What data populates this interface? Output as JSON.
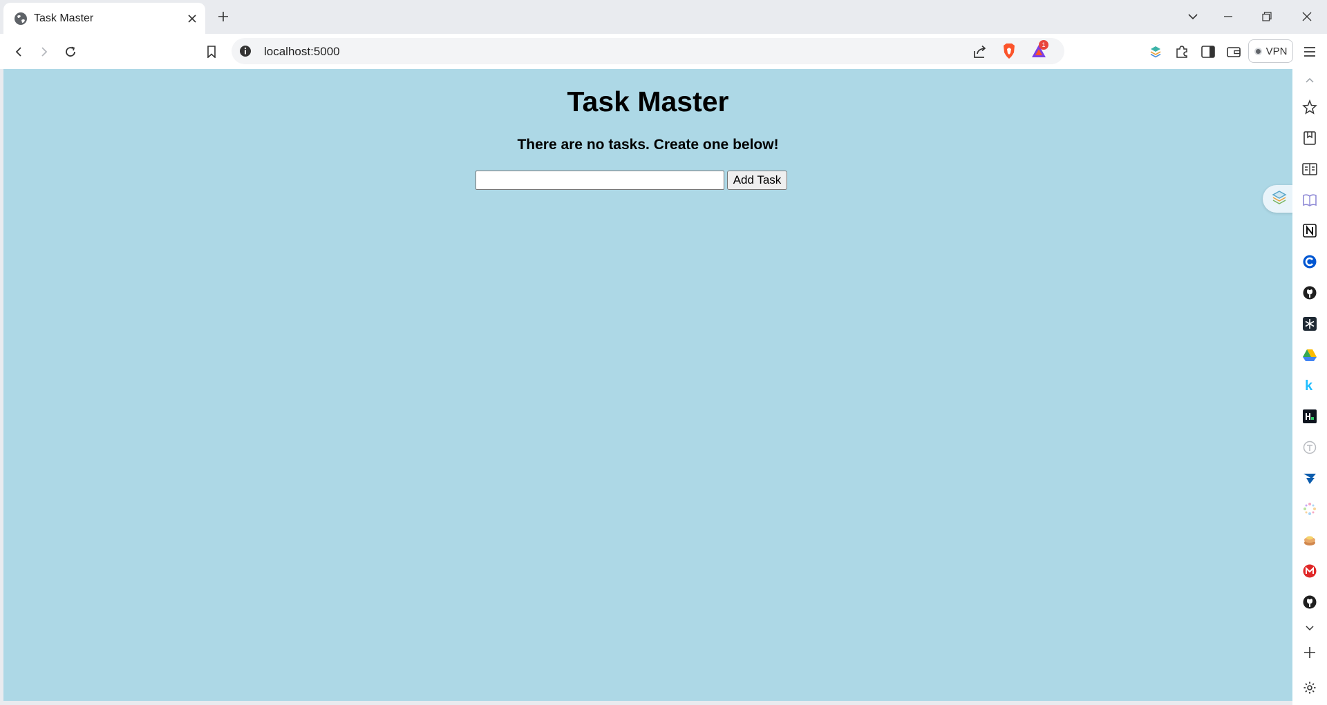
{
  "browser": {
    "tab": {
      "title": "Task Master"
    },
    "address_bar": {
      "url": "localhost:5000"
    },
    "notification_badge": "1",
    "vpn_label": "VPN"
  },
  "page": {
    "title": "Task Master",
    "empty_message": "There are no tasks. Create one below!",
    "task_input": {
      "value": "",
      "placeholder": ""
    },
    "add_button_label": "Add Task"
  },
  "colors": {
    "page_background": "#add8e6",
    "browser_frame": "#e9ebef",
    "brave_lion": "#fb542b",
    "github": "#1f1f1f"
  },
  "sidebar_icons": [
    "chevron-up-icon",
    "star-spark-icon",
    "bookmarks-icon",
    "reading-list-icon",
    "learning-icon",
    "notion-icon",
    "coursera-icon",
    "github-icon",
    "snowflake-icon",
    "google-drive-icon",
    "kaggle-icon",
    "hackerrank-icon",
    "typing-icon",
    "cursor-icon",
    "sparkle-icon",
    "pancake-icon",
    "gmail-icon",
    "github-icon-2",
    "chevron-down-icon",
    "add-icon",
    "settings-icon"
  ]
}
